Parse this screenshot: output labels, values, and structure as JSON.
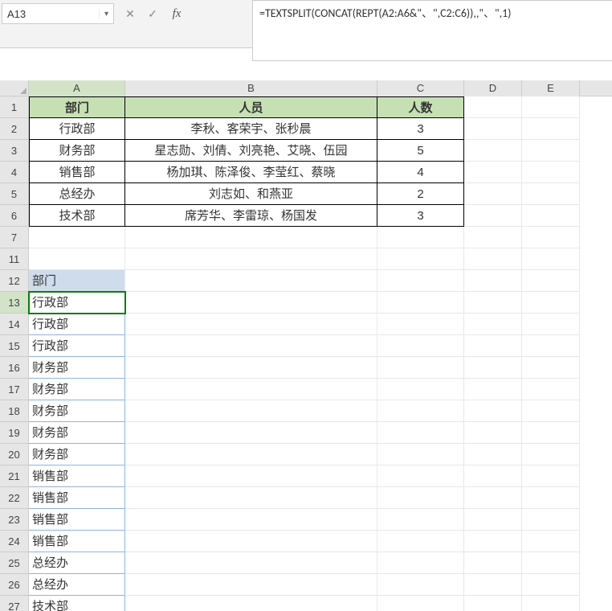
{
  "namebox": "A13",
  "formula": "=TEXTSPLIT(CONCAT(REPT(A2:A6&\"、\",C2:C6)),,\"、\",1)",
  "columns": [
    "A",
    "B",
    "C",
    "D",
    "E"
  ],
  "table_headers": {
    "dept": "部门",
    "people": "人员",
    "count": "人数"
  },
  "table_rows": [
    {
      "dept": "行政部",
      "people": "李秋、客荣宇、张秒晨",
      "count": "3"
    },
    {
      "dept": "财务部",
      "people": "星志勋、刘倩、刘亮艳、艾晓、伍园",
      "count": "5"
    },
    {
      "dept": "销售部",
      "people": "杨加琪、陈泽俊、李莹红、蔡晓",
      "count": "4"
    },
    {
      "dept": "总经办",
      "people": "刘志如、和燕亚",
      "count": "2"
    },
    {
      "dept": "技术部",
      "people": "席芳华、李雷琼、杨国发",
      "count": "3"
    }
  ],
  "spill_label": "部门",
  "spill": [
    "行政部",
    "行政部",
    "行政部",
    "财务部",
    "财务部",
    "财务部",
    "财务部",
    "财务部",
    "销售部",
    "销售部",
    "销售部",
    "销售部",
    "总经办",
    "总经办",
    "技术部"
  ],
  "row_numbers": [
    "1",
    "2",
    "3",
    "4",
    "5",
    "6",
    "7",
    "11",
    "12",
    "13",
    "14",
    "15",
    "16",
    "17",
    "18",
    "19",
    "20",
    "21",
    "22",
    "23",
    "24",
    "25",
    "26",
    "27"
  ],
  "chart_data": {
    "type": "table",
    "columns": [
      "部门",
      "人员",
      "人数"
    ],
    "rows": [
      [
        "行政部",
        "李秋、客荣宇、张秒晨",
        3
      ],
      [
        "财务部",
        "星志勋、刘倩、刘亮艳、艾晓、伍园",
        5
      ],
      [
        "销售部",
        "杨加琪、陈泽俊、李莹红、蔡晓",
        4
      ],
      [
        "总经办",
        "刘志如、和燕亚",
        2
      ],
      [
        "技术部",
        "席芳华、李雷琼、杨国发",
        3
      ]
    ]
  }
}
